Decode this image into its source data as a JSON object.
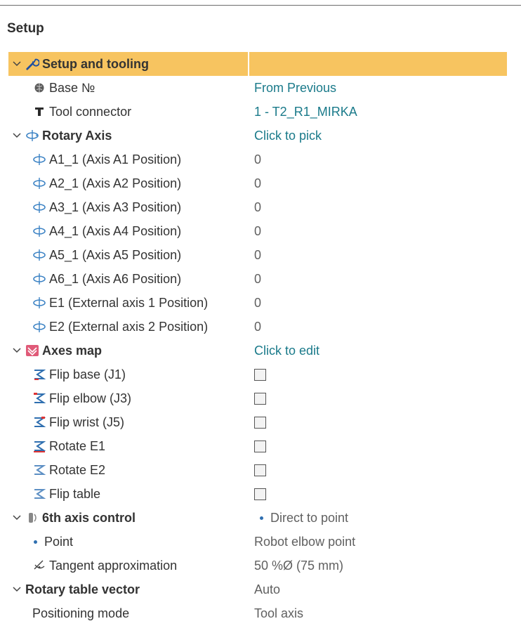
{
  "panel": {
    "title": "Setup"
  },
  "rows": {
    "setup_tooling": {
      "label": "Setup and tooling",
      "value": ""
    },
    "base": {
      "label": "Base №",
      "value": "From Previous"
    },
    "tool_connector": {
      "label": "Tool connector",
      "value": "1 - T2_R1_MIRKA"
    },
    "rotary_axis": {
      "label": "Rotary Axis",
      "value": "Click to pick"
    },
    "a1": {
      "label": "A1_1 (Axis A1 Position)",
      "value": "0"
    },
    "a2": {
      "label": "A2_1 (Axis A2 Position)",
      "value": "0"
    },
    "a3": {
      "label": "A3_1 (Axis A3 Position)",
      "value": "0"
    },
    "a4": {
      "label": "A4_1 (Axis A4 Position)",
      "value": "0"
    },
    "a5": {
      "label": "A5_1 (Axis A5 Position)",
      "value": "0"
    },
    "a6": {
      "label": "A6_1 (Axis A6 Position)",
      "value": "0"
    },
    "e1": {
      "label": "E1 (External axis 1 Position)",
      "value": "0"
    },
    "e2": {
      "label": "E2 (External axis 2 Position)",
      "value": "0"
    },
    "axes_map": {
      "label": "Axes map",
      "value": "Click to edit"
    },
    "flip_base": {
      "label": "Flip base (J1)",
      "checked": false
    },
    "flip_elbow": {
      "label": "Flip elbow (J3)",
      "checked": false
    },
    "flip_wrist": {
      "label": "Flip wrist (J5)",
      "checked": false
    },
    "rotate_e1": {
      "label": "Rotate E1",
      "checked": false
    },
    "rotate_e2": {
      "label": "Rotate E2",
      "checked": false
    },
    "flip_table": {
      "label": "Flip table",
      "checked": false
    },
    "sixth_axis": {
      "label": "6th axis control",
      "value": "Direct to point"
    },
    "point": {
      "label": "Point",
      "value": "Robot elbow point"
    },
    "tangent": {
      "label": "Tangent approximation",
      "value": "50 %Ø (75 mm)"
    },
    "rotary_table_vector": {
      "label": "Rotary table vector",
      "value": "Auto"
    },
    "positioning_mode": {
      "label": "Positioning mode",
      "value": "Tool axis"
    }
  },
  "colors": {
    "highlight": "#f7c460",
    "link": "#1a7a8a",
    "value": "#606060"
  },
  "icons": [
    "chevron-down-icon",
    "wrench-icon",
    "globe-icon",
    "tool-connector-icon",
    "rotary-axis-icon",
    "axes-map-icon",
    "robot-arm-icon",
    "sixth-axis-icon",
    "bullet-icon",
    "tangent-icon"
  ]
}
